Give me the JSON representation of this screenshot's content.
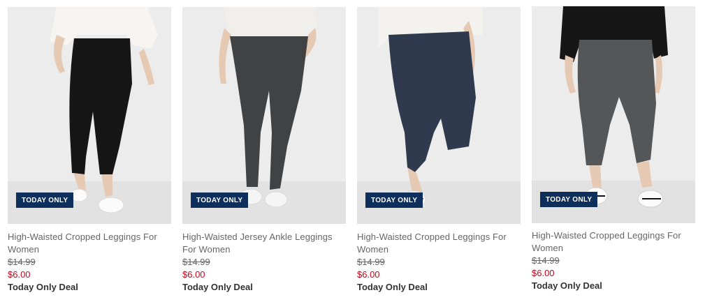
{
  "products": [
    {
      "badge": "TODAY ONLY",
      "title": "High-Waisted Cropped Leggings For Women",
      "was_price": "$14.99",
      "sale_price": "$6.00",
      "deal_label": "Today Only Deal",
      "legging_color": "#161616"
    },
    {
      "badge": "TODAY ONLY",
      "title": "High-Waisted Jersey Ankle Leggings For Women",
      "was_price": "$14.99",
      "sale_price": "$6.00",
      "deal_label": "Today Only Deal",
      "legging_color": "#414244"
    },
    {
      "badge": "TODAY ONLY",
      "title": "High-Waisted Cropped Leggings For Women",
      "was_price": "$14.99",
      "sale_price": "$6.00",
      "deal_label": "Today Only Deal",
      "legging_color": "#2f3a4f"
    },
    {
      "badge": "TODAY ONLY",
      "title": "High-Waisted Cropped Leggings For Women",
      "was_price": "$14.99",
      "sale_price": "$6.00",
      "deal_label": "Today Only Deal",
      "legging_color": "#555658"
    }
  ],
  "colors": {
    "badge_bg": "#0e2f5c",
    "sale_red": "#d0021b"
  }
}
